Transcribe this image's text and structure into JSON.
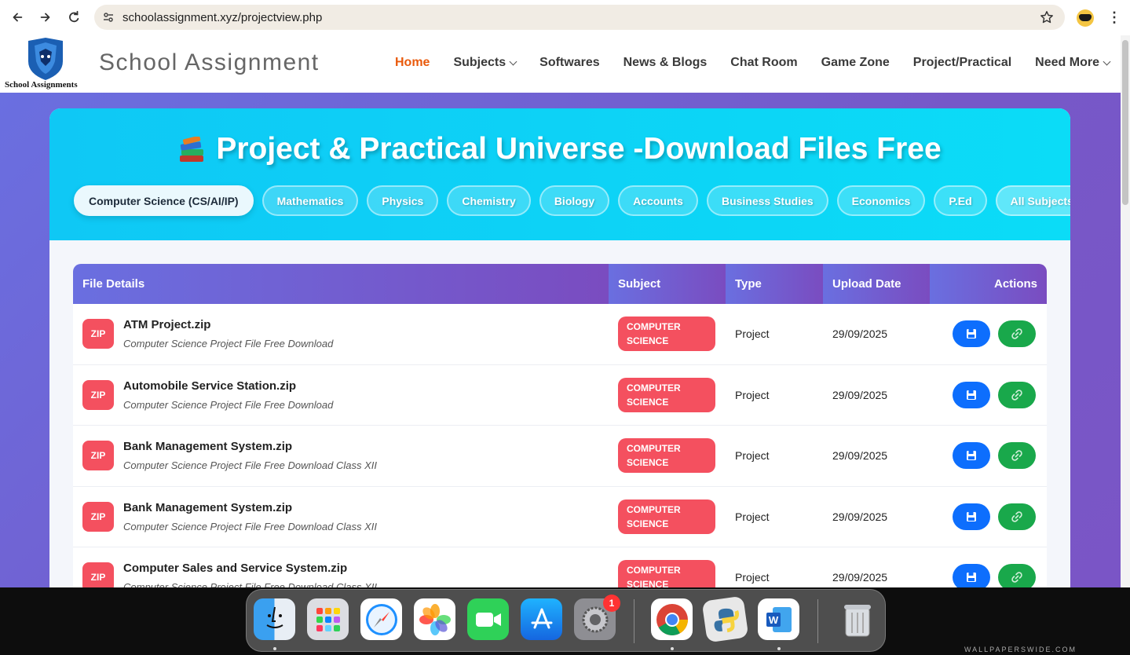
{
  "browser": {
    "url": "schoolassignment.xyz/projectview.php",
    "profile_icon": "batman-avatar-icon"
  },
  "site": {
    "logo_text": "School Assignments",
    "title": "School Assignment",
    "nav": [
      {
        "label": "Home",
        "active": true,
        "dropdown": false
      },
      {
        "label": "Subjects",
        "active": false,
        "dropdown": true
      },
      {
        "label": "Softwares",
        "active": false,
        "dropdown": false
      },
      {
        "label": "News & Blogs",
        "active": false,
        "dropdown": false
      },
      {
        "label": "Chat Room",
        "active": false,
        "dropdown": false
      },
      {
        "label": "Game Zone",
        "active": false,
        "dropdown": false
      },
      {
        "label": "Project/Practical",
        "active": false,
        "dropdown": false
      },
      {
        "label": "Need More",
        "active": false,
        "dropdown": true
      }
    ]
  },
  "hero": {
    "title": "Project & Practical Universe -Download Files Free",
    "subjects": [
      {
        "label": "Computer Science (CS/AI/IP)",
        "active": true
      },
      {
        "label": "Mathematics",
        "active": false
      },
      {
        "label": "Physics",
        "active": false
      },
      {
        "label": "Chemistry",
        "active": false
      },
      {
        "label": "Biology",
        "active": false
      },
      {
        "label": "Accounts",
        "active": false
      },
      {
        "label": "Business Studies",
        "active": false
      },
      {
        "label": "Economics",
        "active": false
      },
      {
        "label": "P.Ed",
        "active": false
      },
      {
        "label": "All Subjects",
        "active": false
      }
    ]
  },
  "table": {
    "headers": {
      "file": "File Details",
      "subject": "Subject",
      "type": "Type",
      "date": "Upload Date",
      "actions": "Actions"
    },
    "file_badge": "ZIP",
    "rows": [
      {
        "name": "ATM Project.zip",
        "desc": "Computer Science Project File Free Download",
        "subject": "COMPUTER SCIENCE",
        "type": "Project",
        "date": "29/09/2025"
      },
      {
        "name": "Automobile Service Station.zip",
        "desc": "Computer Science Project File Free Download",
        "subject": "COMPUTER SCIENCE",
        "type": "Project",
        "date": "29/09/2025"
      },
      {
        "name": "Bank Management System.zip",
        "desc": "Computer Science Project File Free Download Class XII",
        "subject": "COMPUTER SCIENCE",
        "type": "Project",
        "date": "29/09/2025"
      },
      {
        "name": "Bank Management System.zip",
        "desc": "Computer Science Project File Free Download Class XII",
        "subject": "COMPUTER SCIENCE",
        "type": "Project",
        "date": "29/09/2025"
      },
      {
        "name": "Computer Sales and Service System.zip",
        "desc": "Computer Science Project File Free Download Class XII",
        "subject": "COMPUTER SCIENCE",
        "type": "Project",
        "date": "29/09/2025"
      }
    ]
  },
  "colors": {
    "accent_orange": "#e95a0c",
    "zip_red": "#f4505f",
    "save_blue": "#0d6efd",
    "link_green": "#19a84b",
    "hero_cyan": "#0fc8f5",
    "header_purple": "#7658c8"
  },
  "dock": {
    "apps": [
      {
        "name": "finder-icon"
      },
      {
        "name": "launchpad-icon"
      },
      {
        "name": "safari-icon"
      },
      {
        "name": "photos-icon"
      },
      {
        "name": "facetime-icon"
      },
      {
        "name": "app-store-icon"
      },
      {
        "name": "system-settings-icon",
        "badge": "1"
      },
      {
        "name": "chrome-icon"
      },
      {
        "name": "python-launcher-icon"
      },
      {
        "name": "word-icon"
      },
      {
        "name": "trash-icon"
      }
    ]
  },
  "wallpaper_mark": "WALLPAPERSWIDE.COM"
}
